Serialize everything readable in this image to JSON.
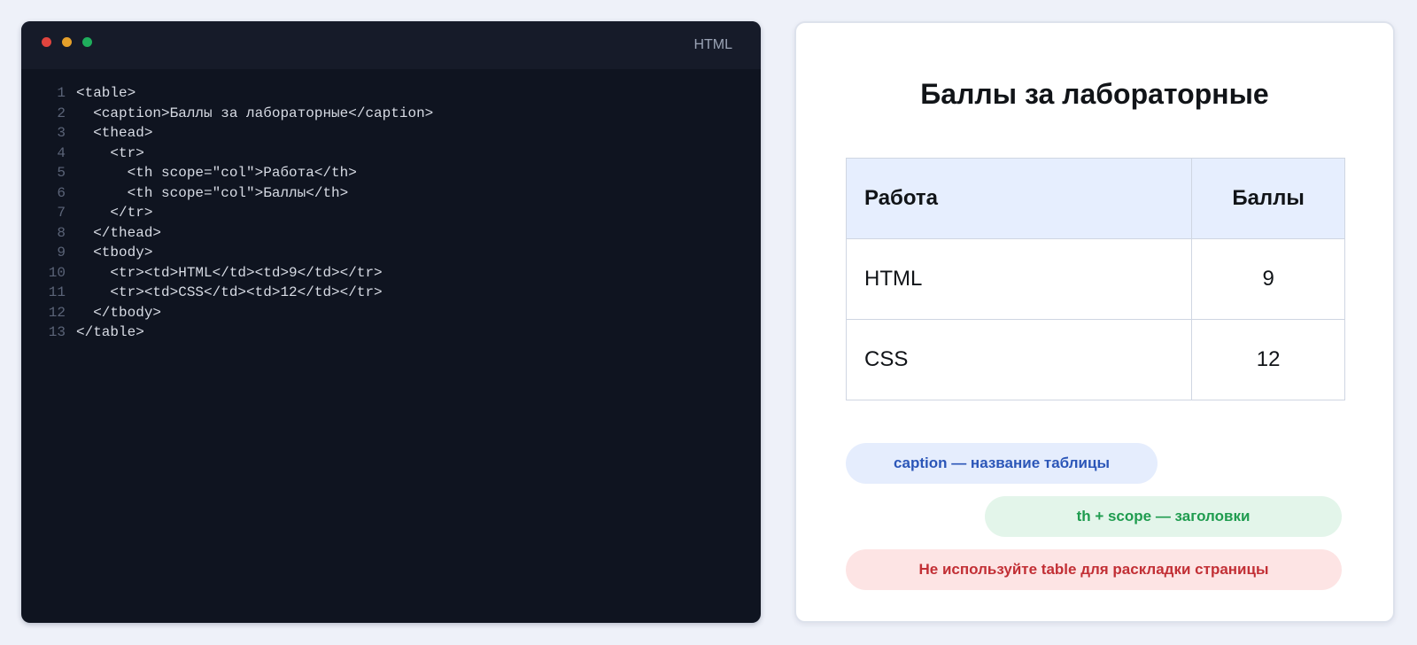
{
  "editor": {
    "language": "HTML",
    "lines": [
      {
        "num": "1",
        "code": "<table>"
      },
      {
        "num": "2",
        "code": "  <caption>Баллы за лабораторные</caption>"
      },
      {
        "num": "3",
        "code": "  <thead>"
      },
      {
        "num": "4",
        "code": "    <tr>"
      },
      {
        "num": "5",
        "code": "      <th scope=\"col\">Работа</th>"
      },
      {
        "num": "6",
        "code": "      <th scope=\"col\">Баллы</th>"
      },
      {
        "num": "7",
        "code": "    </tr>"
      },
      {
        "num": "8",
        "code": "  </thead>"
      },
      {
        "num": "9",
        "code": "  <tbody>"
      },
      {
        "num": "10",
        "code": "    <tr><td>HTML</td><td>9</td></tr>"
      },
      {
        "num": "11",
        "code": "    <tr><td>CSS</td><td>12</td></tr>"
      },
      {
        "num": "12",
        "code": "  </tbody>"
      },
      {
        "num": "13",
        "code": "</table>"
      }
    ]
  },
  "preview": {
    "caption": "Баллы за лабораторные",
    "headers": [
      "Работа",
      "Баллы"
    ],
    "rows": [
      [
        "HTML",
        "9"
      ],
      [
        "CSS",
        "12"
      ]
    ]
  },
  "notes": {
    "caption_note": "caption — название таблицы",
    "th_note": "th + scope — заголовки",
    "warning_note": "Не используйте table для раскладки страницы"
  },
  "colors": {
    "editor_bg": "#0f1420",
    "header_cell_bg": "#e6eefe",
    "note_blue": "#2b56b8",
    "note_green": "#1f9c4f",
    "note_red": "#c22f35"
  }
}
